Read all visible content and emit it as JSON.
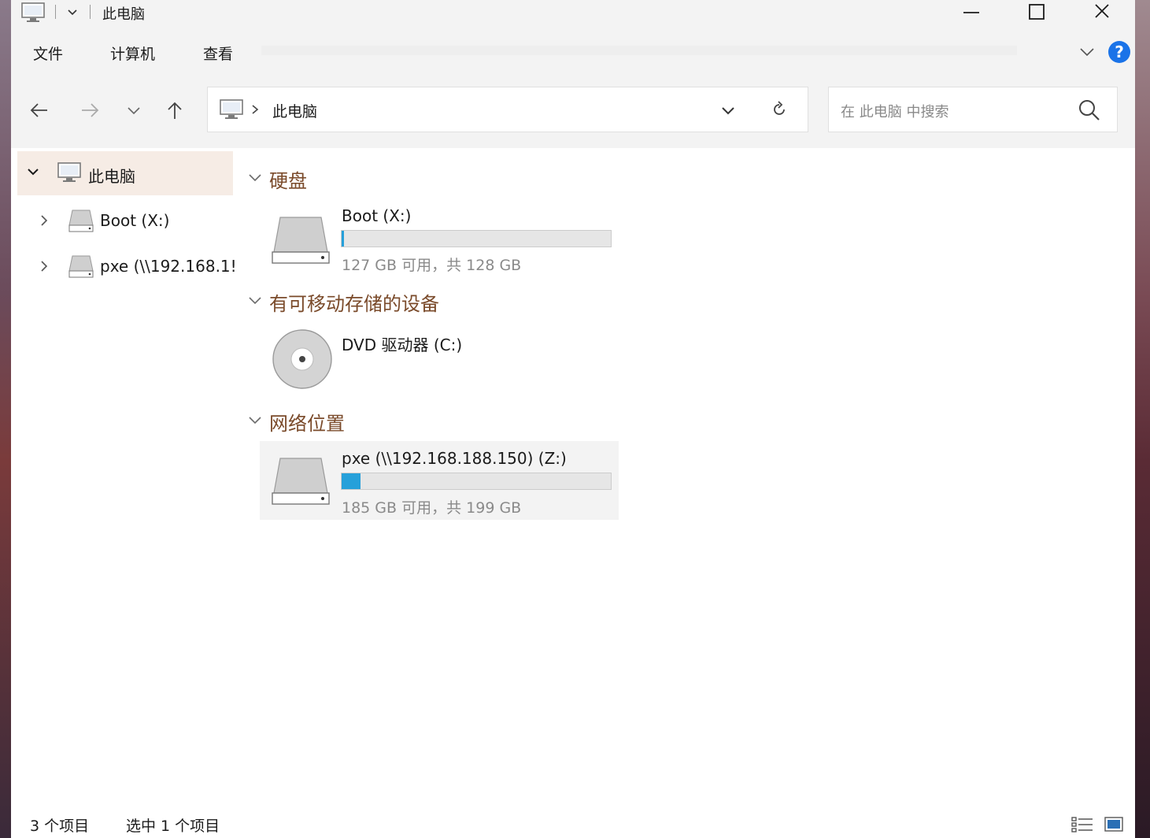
{
  "window": {
    "title": "此电脑"
  },
  "ribbon": {
    "tabs": [
      "文件",
      "计算机",
      "查看"
    ],
    "help_label": "?"
  },
  "nav": {
    "address_path": "此电脑",
    "search_placeholder": "在 此电脑 中搜索"
  },
  "sidebar": {
    "items": [
      {
        "label": "此电脑",
        "icon": "computer-icon",
        "expanded": true,
        "selected": true
      },
      {
        "label": "Boot (X:)",
        "icon": "drive-icon",
        "expanded": false
      },
      {
        "label": "pxe (\\\\192.168.1!",
        "icon": "network-drive-icon",
        "expanded": false
      }
    ]
  },
  "groups": [
    {
      "title": "硬盘",
      "items": [
        {
          "name": "Boot (X:)",
          "icon": "drive-icon",
          "info": "127 GB 可用，共 128 GB",
          "used_fraction": 0.008
        }
      ]
    },
    {
      "title": "有可移动存储的设备",
      "items": [
        {
          "name": "DVD 驱动器 (C:)",
          "icon": "dvd-icon"
        }
      ]
    },
    {
      "title": "网络位置",
      "items": [
        {
          "name": "pxe (\\\\192.168.188.150) (Z:)",
          "icon": "network-drive-icon",
          "info": "185 GB 可用，共 199 GB",
          "used_fraction": 0.07,
          "selected": true
        }
      ]
    }
  ],
  "status": {
    "count": "3 个项目",
    "selected": "选中 1 个项目"
  },
  "colors": {
    "accent": "#26a0da",
    "group_header": "#7a4a2a",
    "selection": "#f6ece5"
  }
}
